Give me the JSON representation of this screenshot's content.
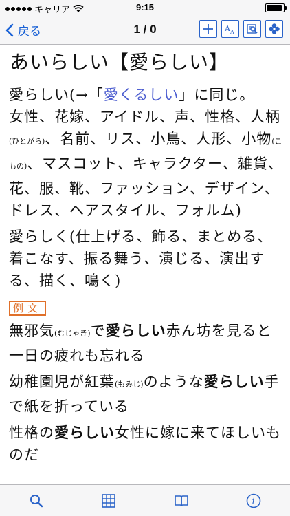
{
  "status_bar": {
    "carrier": "キャリア",
    "time": "9:15"
  },
  "nav": {
    "back_label": "戻る",
    "pager": "1 / 0"
  },
  "toolbar": {
    "font_size_label": "AA"
  },
  "entry": {
    "headword": "あいらしい【愛らしい】",
    "def1_a": "愛らしい(→「",
    "def1_link": "愛くるしい",
    "def1_b": "」に同じ。",
    "def2_a": "女性、花嫁、アイドル、声、性格、人柄",
    "def2_ruby1": "(ひとがら)",
    "def2_b": "、名前、リス、小鳥、人形、小物",
    "def2_ruby2": "(こもの)",
    "def2_c": "、マスコット、キャラクター、雑貨、花、服、靴、ファッション、デザイン、ドレス、ヘアスタイル、フォルム)",
    "def3": "愛らしく(仕上げる、飾る、まとめる、着こなす、振る舞う、演じる、演出する、描く、鳴く)",
    "example_label": "例文",
    "ex1_a": "無邪気",
    "ex1_ruby": "(むじゃき)",
    "ex1_b": "で",
    "ex1_bold": "愛らしい",
    "ex1_c": "赤ん坊を見ると一日の疲れも忘れる",
    "ex2_a": "幼稚園児が紅葉",
    "ex2_ruby": "(もみじ)",
    "ex2_b": "のような",
    "ex2_bold": "愛らしい",
    "ex2_c": "手で紙を折っている",
    "ex3_a": "性格の",
    "ex3_bold": "愛らしい",
    "ex3_b": "女性に嫁に来てほしいものだ"
  },
  "icons": {
    "nav_back": "chevron-left-icon",
    "tool1": "plus-icon",
    "tool2": "font-size-icon",
    "tool3": "search-document-icon",
    "tool4": "flower-icon",
    "tab1": "search-icon",
    "tab2": "grid-icon",
    "tab3": "book-icon",
    "tab4": "info-icon"
  },
  "colors": {
    "accent": "#2a63c9",
    "link": "#4d5ed0",
    "example_badge": "#e0702a"
  }
}
